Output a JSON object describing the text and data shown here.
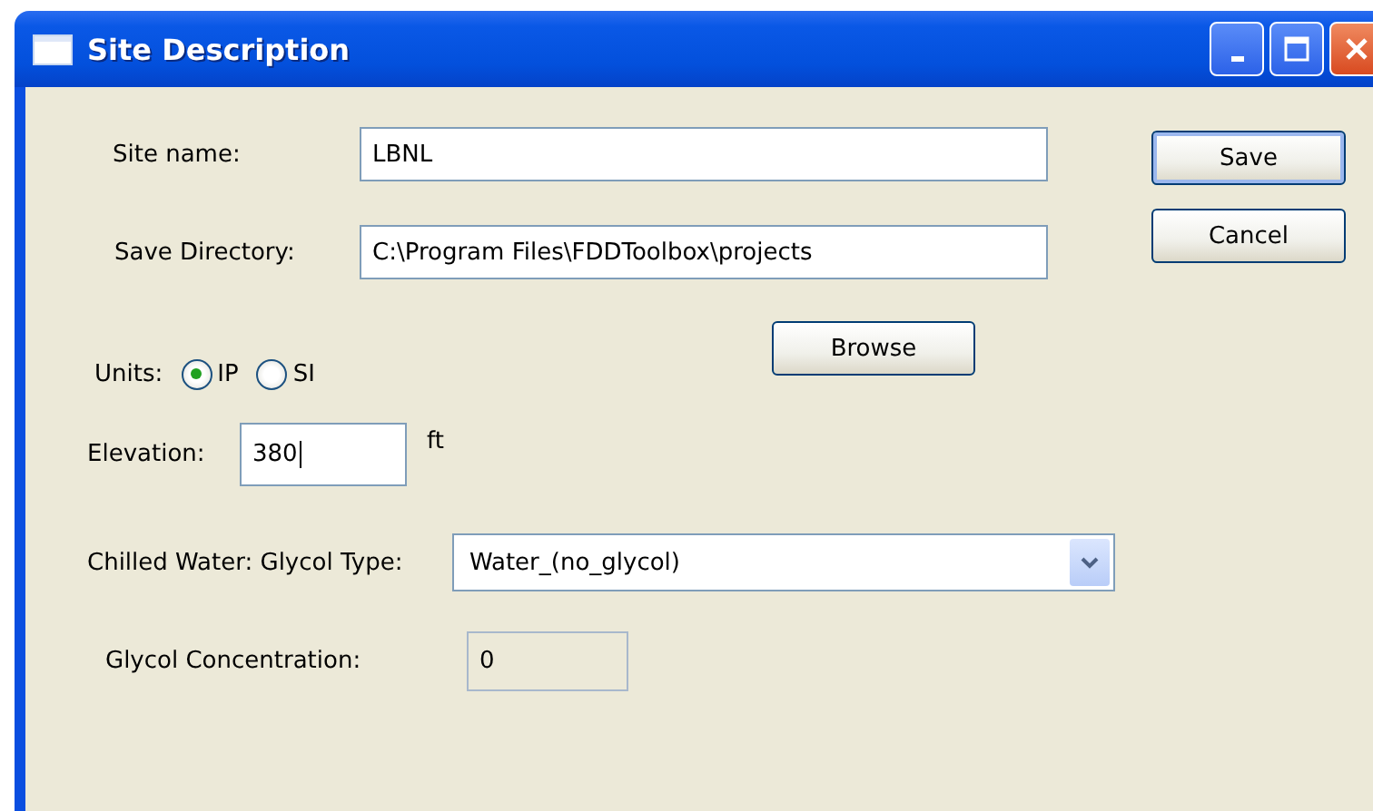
{
  "window": {
    "title": "Site Description"
  },
  "fields": [
    {
      "label": "Site name:",
      "value": "LBNL"
    },
    {
      "label": "Save Directory:",
      "value": "C:\\Program Files\\FDDToolbox\\projects"
    }
  ],
  "browse_button": "Browse",
  "units": {
    "label": "Units:",
    "options": [
      {
        "label": "IP",
        "selected": true
      },
      {
        "label": "SI",
        "selected": false
      }
    ]
  },
  "elevation": {
    "label": "Elevation:",
    "value": "380",
    "unit": "ft"
  },
  "glycol_type": {
    "label": "Chilled Water: Glycol Type:",
    "value": "Water_(no_glycol)"
  },
  "glycol_concentration": {
    "label": "Glycol Concentration:",
    "value": "0",
    "disabled": true
  },
  "buttons": [
    "Save",
    "Cancel"
  ]
}
